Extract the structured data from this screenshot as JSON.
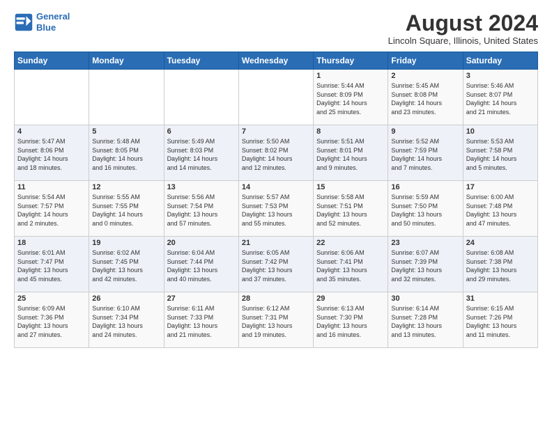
{
  "header": {
    "logo_line1": "General",
    "logo_line2": "Blue",
    "month_title": "August 2024",
    "location": "Lincoln Square, Illinois, United States"
  },
  "days_of_week": [
    "Sunday",
    "Monday",
    "Tuesday",
    "Wednesday",
    "Thursday",
    "Friday",
    "Saturday"
  ],
  "weeks": [
    [
      {
        "day": "",
        "info": ""
      },
      {
        "day": "",
        "info": ""
      },
      {
        "day": "",
        "info": ""
      },
      {
        "day": "",
        "info": ""
      },
      {
        "day": "1",
        "info": "Sunrise: 5:44 AM\nSunset: 8:09 PM\nDaylight: 14 hours\nand 25 minutes."
      },
      {
        "day": "2",
        "info": "Sunrise: 5:45 AM\nSunset: 8:08 PM\nDaylight: 14 hours\nand 23 minutes."
      },
      {
        "day": "3",
        "info": "Sunrise: 5:46 AM\nSunset: 8:07 PM\nDaylight: 14 hours\nand 21 minutes."
      }
    ],
    [
      {
        "day": "4",
        "info": "Sunrise: 5:47 AM\nSunset: 8:06 PM\nDaylight: 14 hours\nand 18 minutes."
      },
      {
        "day": "5",
        "info": "Sunrise: 5:48 AM\nSunset: 8:05 PM\nDaylight: 14 hours\nand 16 minutes."
      },
      {
        "day": "6",
        "info": "Sunrise: 5:49 AM\nSunset: 8:03 PM\nDaylight: 14 hours\nand 14 minutes."
      },
      {
        "day": "7",
        "info": "Sunrise: 5:50 AM\nSunset: 8:02 PM\nDaylight: 14 hours\nand 12 minutes."
      },
      {
        "day": "8",
        "info": "Sunrise: 5:51 AM\nSunset: 8:01 PM\nDaylight: 14 hours\nand 9 minutes."
      },
      {
        "day": "9",
        "info": "Sunrise: 5:52 AM\nSunset: 7:59 PM\nDaylight: 14 hours\nand 7 minutes."
      },
      {
        "day": "10",
        "info": "Sunrise: 5:53 AM\nSunset: 7:58 PM\nDaylight: 14 hours\nand 5 minutes."
      }
    ],
    [
      {
        "day": "11",
        "info": "Sunrise: 5:54 AM\nSunset: 7:57 PM\nDaylight: 14 hours\nand 2 minutes."
      },
      {
        "day": "12",
        "info": "Sunrise: 5:55 AM\nSunset: 7:55 PM\nDaylight: 14 hours\nand 0 minutes."
      },
      {
        "day": "13",
        "info": "Sunrise: 5:56 AM\nSunset: 7:54 PM\nDaylight: 13 hours\nand 57 minutes."
      },
      {
        "day": "14",
        "info": "Sunrise: 5:57 AM\nSunset: 7:53 PM\nDaylight: 13 hours\nand 55 minutes."
      },
      {
        "day": "15",
        "info": "Sunrise: 5:58 AM\nSunset: 7:51 PM\nDaylight: 13 hours\nand 52 minutes."
      },
      {
        "day": "16",
        "info": "Sunrise: 5:59 AM\nSunset: 7:50 PM\nDaylight: 13 hours\nand 50 minutes."
      },
      {
        "day": "17",
        "info": "Sunrise: 6:00 AM\nSunset: 7:48 PM\nDaylight: 13 hours\nand 47 minutes."
      }
    ],
    [
      {
        "day": "18",
        "info": "Sunrise: 6:01 AM\nSunset: 7:47 PM\nDaylight: 13 hours\nand 45 minutes."
      },
      {
        "day": "19",
        "info": "Sunrise: 6:02 AM\nSunset: 7:45 PM\nDaylight: 13 hours\nand 42 minutes."
      },
      {
        "day": "20",
        "info": "Sunrise: 6:04 AM\nSunset: 7:44 PM\nDaylight: 13 hours\nand 40 minutes."
      },
      {
        "day": "21",
        "info": "Sunrise: 6:05 AM\nSunset: 7:42 PM\nDaylight: 13 hours\nand 37 minutes."
      },
      {
        "day": "22",
        "info": "Sunrise: 6:06 AM\nSunset: 7:41 PM\nDaylight: 13 hours\nand 35 minutes."
      },
      {
        "day": "23",
        "info": "Sunrise: 6:07 AM\nSunset: 7:39 PM\nDaylight: 13 hours\nand 32 minutes."
      },
      {
        "day": "24",
        "info": "Sunrise: 6:08 AM\nSunset: 7:38 PM\nDaylight: 13 hours\nand 29 minutes."
      }
    ],
    [
      {
        "day": "25",
        "info": "Sunrise: 6:09 AM\nSunset: 7:36 PM\nDaylight: 13 hours\nand 27 minutes."
      },
      {
        "day": "26",
        "info": "Sunrise: 6:10 AM\nSunset: 7:34 PM\nDaylight: 13 hours\nand 24 minutes."
      },
      {
        "day": "27",
        "info": "Sunrise: 6:11 AM\nSunset: 7:33 PM\nDaylight: 13 hours\nand 21 minutes."
      },
      {
        "day": "28",
        "info": "Sunrise: 6:12 AM\nSunset: 7:31 PM\nDaylight: 13 hours\nand 19 minutes."
      },
      {
        "day": "29",
        "info": "Sunrise: 6:13 AM\nSunset: 7:30 PM\nDaylight: 13 hours\nand 16 minutes."
      },
      {
        "day": "30",
        "info": "Sunrise: 6:14 AM\nSunset: 7:28 PM\nDaylight: 13 hours\nand 13 minutes."
      },
      {
        "day": "31",
        "info": "Sunrise: 6:15 AM\nSunset: 7:26 PM\nDaylight: 13 hours\nand 11 minutes."
      }
    ]
  ]
}
